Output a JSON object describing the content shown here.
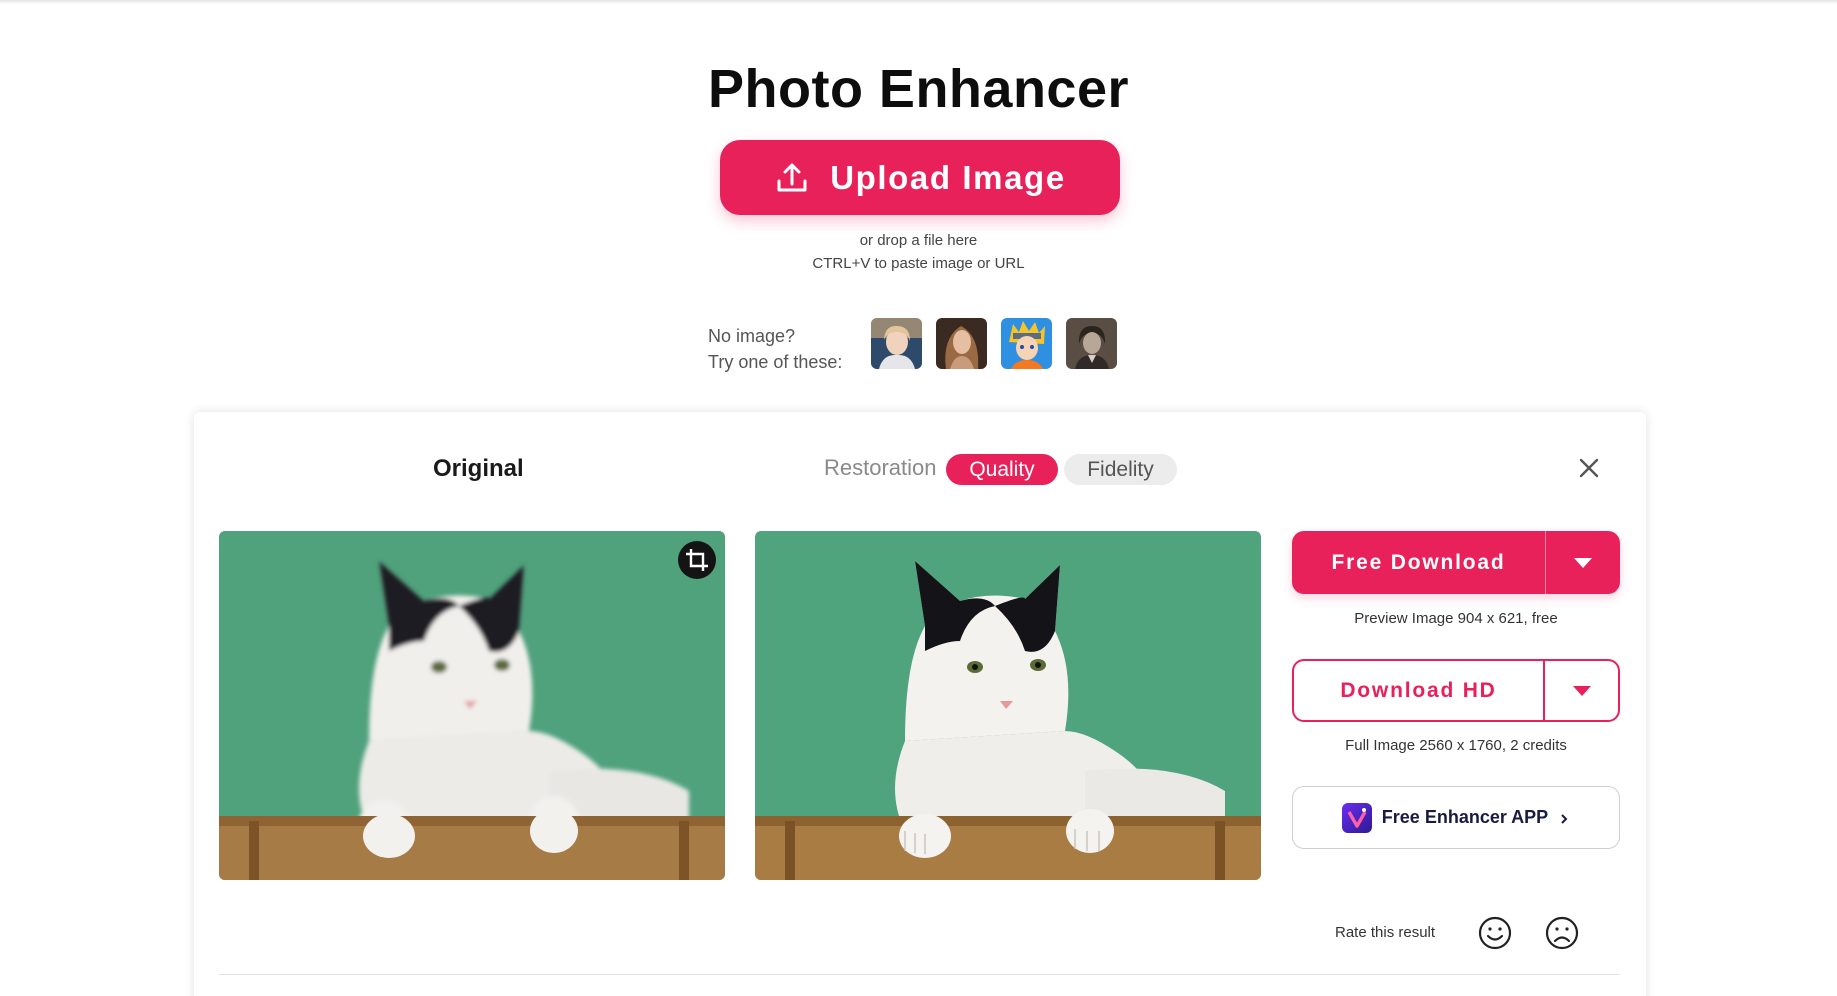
{
  "page": {
    "title": "Photo Enhancer"
  },
  "upload": {
    "button_label": "Upload Image",
    "icon": "upload-icon",
    "drop_hint": "or drop a file here",
    "paste_hint": "CTRL+V to paste image or URL"
  },
  "samples": {
    "label_line1": "No image?",
    "label_line2": "Try one of these:",
    "items": [
      {
        "name": "sample-girl-portrait"
      },
      {
        "name": "sample-woman-portrait"
      },
      {
        "name": "sample-anime-character"
      },
      {
        "name": "sample-vintage-portrait"
      }
    ]
  },
  "result": {
    "original_label": "Original",
    "tabs": [
      {
        "label": "Restoration",
        "active": false
      },
      {
        "label": "Quality",
        "active": true
      },
      {
        "label": "Fidelity",
        "active": false
      }
    ],
    "close_icon": "close-icon",
    "crop_icon": "crop-icon"
  },
  "downloads": {
    "free_label": "Free Download",
    "free_caption": "Preview Image 904 x 621, free",
    "hd_label": "Download HD",
    "hd_caption": "Full Image 2560 x 1760, 2 credits",
    "app_label": "Free Enhancer APP"
  },
  "rating": {
    "label": "Rate this result",
    "icons": [
      "smile-icon",
      "frown-icon"
    ]
  },
  "colors": {
    "accent": "#e8215a",
    "background": "#ffffff",
    "tab_inactive_bg": "#ececec"
  }
}
